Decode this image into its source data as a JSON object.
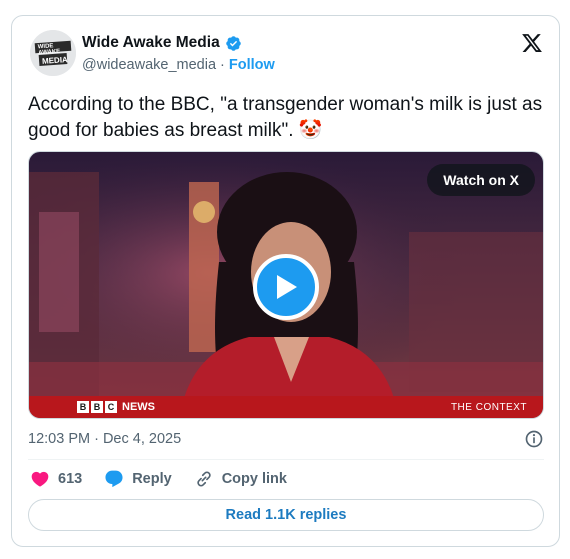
{
  "tweet": {
    "author": {
      "display_name": "Wide Awake Media",
      "handle": "@wideawake_media",
      "follow_label": "Follow",
      "avatar_text_top": "WIDE AWAKE",
      "avatar_text_bottom": "MEDIA",
      "verified": true
    },
    "text": "According to the BBC, \"a transgender woman's milk is just as good for babies as breast milk\". 🤡",
    "media": {
      "watch_label": "Watch on X",
      "bbc_letters": [
        "B",
        "B",
        "C"
      ],
      "news_label": "NEWS",
      "context_label": "THE CONTEXT"
    },
    "timestamp": "12:03 PM · Dec 4, 2025",
    "actions": {
      "likes_count": "613",
      "reply_label": "Reply",
      "copy_link_label": "Copy link"
    },
    "read_replies_label": "Read 1.1K replies"
  },
  "colors": {
    "accent": "#1d9bf0",
    "like_heart": "#f91880",
    "ticker_red": "#b8171c"
  },
  "icons": [
    "verified-badge-icon",
    "x-logo-icon",
    "play-icon",
    "info-icon",
    "heart-icon",
    "reply-bubble-icon",
    "link-icon"
  ]
}
